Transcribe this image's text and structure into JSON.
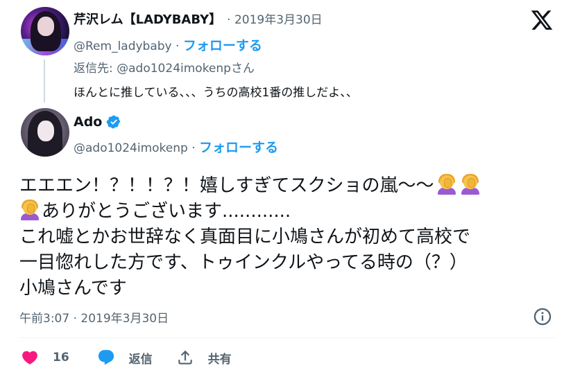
{
  "parent": {
    "name": "芹沢レム【LADYBABY】",
    "date": "· 2019年3月30日",
    "handle": "@Rem_ladybaby",
    "dot": "·",
    "follow": "フォローする",
    "reply_to": "返信先: @ado1024imokenpさん",
    "text": "ほんとに推している、、、うちの高校1番の推しだよ、、"
  },
  "main": {
    "name": "Ado",
    "handle": "@ado1024imokenp",
    "dot": "·",
    "follow": "フォローする",
    "text_lines": [
      "エエエン！？！！？！嬉しすぎてスクショの嵐～～",
      "ありがとうございます............",
      "これ嘘とかお世辞なく真面目に小鳩さんが初めて高校で",
      "一目惚れした方です、トゥインクルやってる時の（？）",
      "小鳩さんです"
    ],
    "timestamp": "午前3:07 · 2019年3月30日"
  },
  "actions": {
    "like_count": "16",
    "reply_label": "返信",
    "share_label": "共有"
  },
  "icons": {
    "logo": "x-logo-icon",
    "verified": "verified-badge-icon",
    "emoji": "person-facepalming-emoji",
    "info": "info-icon",
    "heart": "heart-icon",
    "reply": "reply-bubble-icon",
    "share": "share-icon"
  },
  "colors": {
    "accent": "#1d9bf0",
    "like": "#f91880",
    "secondary_text": "#536471"
  }
}
